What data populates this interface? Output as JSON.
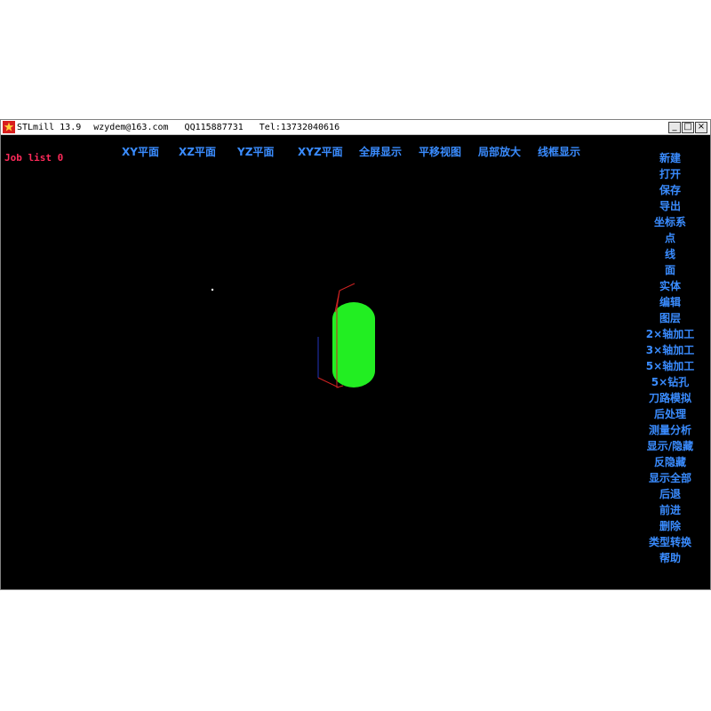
{
  "window": {
    "app_name": "STLmill 13.9",
    "email": "wzydem@163.com",
    "qq": "QQ115887731",
    "tel": "Tel:13732040616",
    "buttons": {
      "minimize": "_",
      "maximize": "□",
      "close": "×"
    }
  },
  "status": {
    "job_list": "Job list 0"
  },
  "toolbar": {
    "items": [
      "XY平面",
      "XZ平面",
      "YZ平面",
      "XYZ平面",
      "全屏显示",
      "平移视图",
      "局部放大",
      "线框显示"
    ]
  },
  "side_menu": {
    "items": [
      "新建",
      "打开",
      "保存",
      "导出",
      "坐标系",
      "点",
      "线",
      "面",
      "实体",
      "编辑",
      "图层",
      "2×轴加工",
      "3×轴加工",
      "5×轴加工",
      "5×钻孔",
      "刀路模拟",
      "后处理",
      "测量分析",
      "显示/隐藏",
      "反隐藏",
      "显示全部",
      "后退",
      "前进",
      "删除",
      "类型转换",
      "帮助"
    ]
  },
  "colors": {
    "viewport_bg": "#000000",
    "menu_text": "#3a8cff",
    "job_text": "#ff2a5a",
    "model": "#22ee22",
    "axis_red": "#cc2222",
    "axis_blue": "#2233bb"
  },
  "icons": {
    "app": "stlmill-app-icon"
  }
}
